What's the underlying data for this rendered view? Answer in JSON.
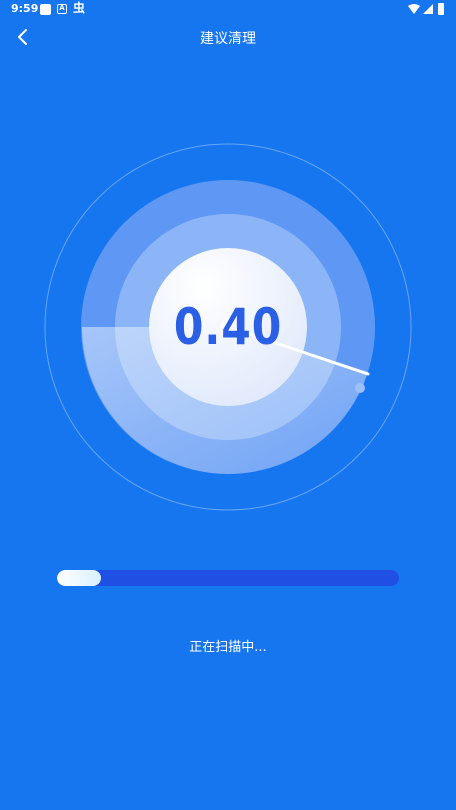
{
  "status_bar": {
    "time": "9:59",
    "badge_letter": "A",
    "bug_icon_char": "虫"
  },
  "nav": {
    "title": "建议清理",
    "back_icon": "chevron-left-icon"
  },
  "gauge": {
    "value": "0.40"
  },
  "progress": {
    "fraction": 0.13
  },
  "scan": {
    "status_text": "正在扫描中..."
  },
  "colors": {
    "background": "#1676f0",
    "progress_track": "#1f4fe3",
    "gauge_text": "#2a5fe6"
  }
}
